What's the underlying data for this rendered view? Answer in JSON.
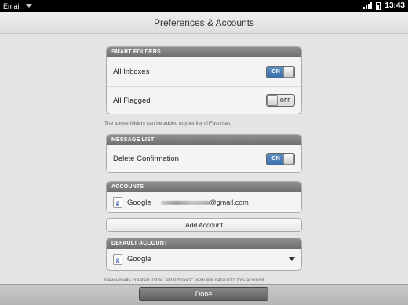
{
  "status_bar": {
    "app_name": "Email",
    "time": "13:43"
  },
  "header": {
    "title": "Preferences & Accounts"
  },
  "smart_folders": {
    "header": "SMART FOLDERS",
    "rows": [
      {
        "label": "All Inboxes",
        "toggle": "ON"
      },
      {
        "label": "All Flagged",
        "toggle": "OFF"
      }
    ],
    "note": "The above folders can be added to your list of Favorites."
  },
  "message_list": {
    "header": "MESSAGE LIST",
    "rows": [
      {
        "label": "Delete Confirmation",
        "toggle": "ON"
      }
    ]
  },
  "accounts": {
    "header": "ACCOUNTS",
    "items": [
      {
        "icon": "google-icon",
        "icon_glyph": "g",
        "name": "Google",
        "email_suffix": "@gmail.com"
      }
    ],
    "add_label": "Add Account"
  },
  "default_account": {
    "header": "DEFAULT ACCOUNT",
    "icon_glyph": "g",
    "selected": "Google",
    "note": "New emails created in the \"All Inboxes\" view will default to this account."
  },
  "footer": {
    "done_label": "Done"
  },
  "colors": {
    "toggle_on": "#3b6fa8",
    "group_header": "#7a7a7a",
    "background": "#e4e4e4"
  }
}
